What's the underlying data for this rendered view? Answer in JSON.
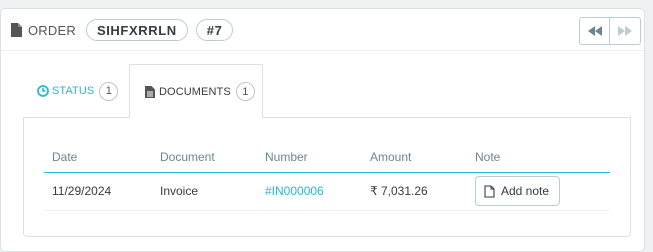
{
  "heading": {
    "title": "ORDER",
    "reference": "SIHFXRRLN",
    "number": "#7",
    "icon": "document-icon"
  },
  "nav": {
    "previous_icon": "backward-icon",
    "next_icon": "forward-icon"
  },
  "tabs": [
    {
      "label": "STATUS",
      "count": "1",
      "icon": "clock-icon",
      "active": false
    },
    {
      "label": "DOCUMENTS",
      "count": "1",
      "icon": "document-icon",
      "active": true
    }
  ],
  "documents_table": {
    "headers": [
      "Date",
      "Document",
      "Number",
      "Amount",
      "Note"
    ],
    "rows": [
      {
        "date": "11/29/2024",
        "document": "Invoice",
        "number": "#IN000006",
        "amount": "₹ 7,031.26",
        "note_button": "Add note"
      }
    ]
  },
  "colors": {
    "accent": "#25b9d7",
    "text": "#363a41",
    "border": "#bbcdd2"
  }
}
